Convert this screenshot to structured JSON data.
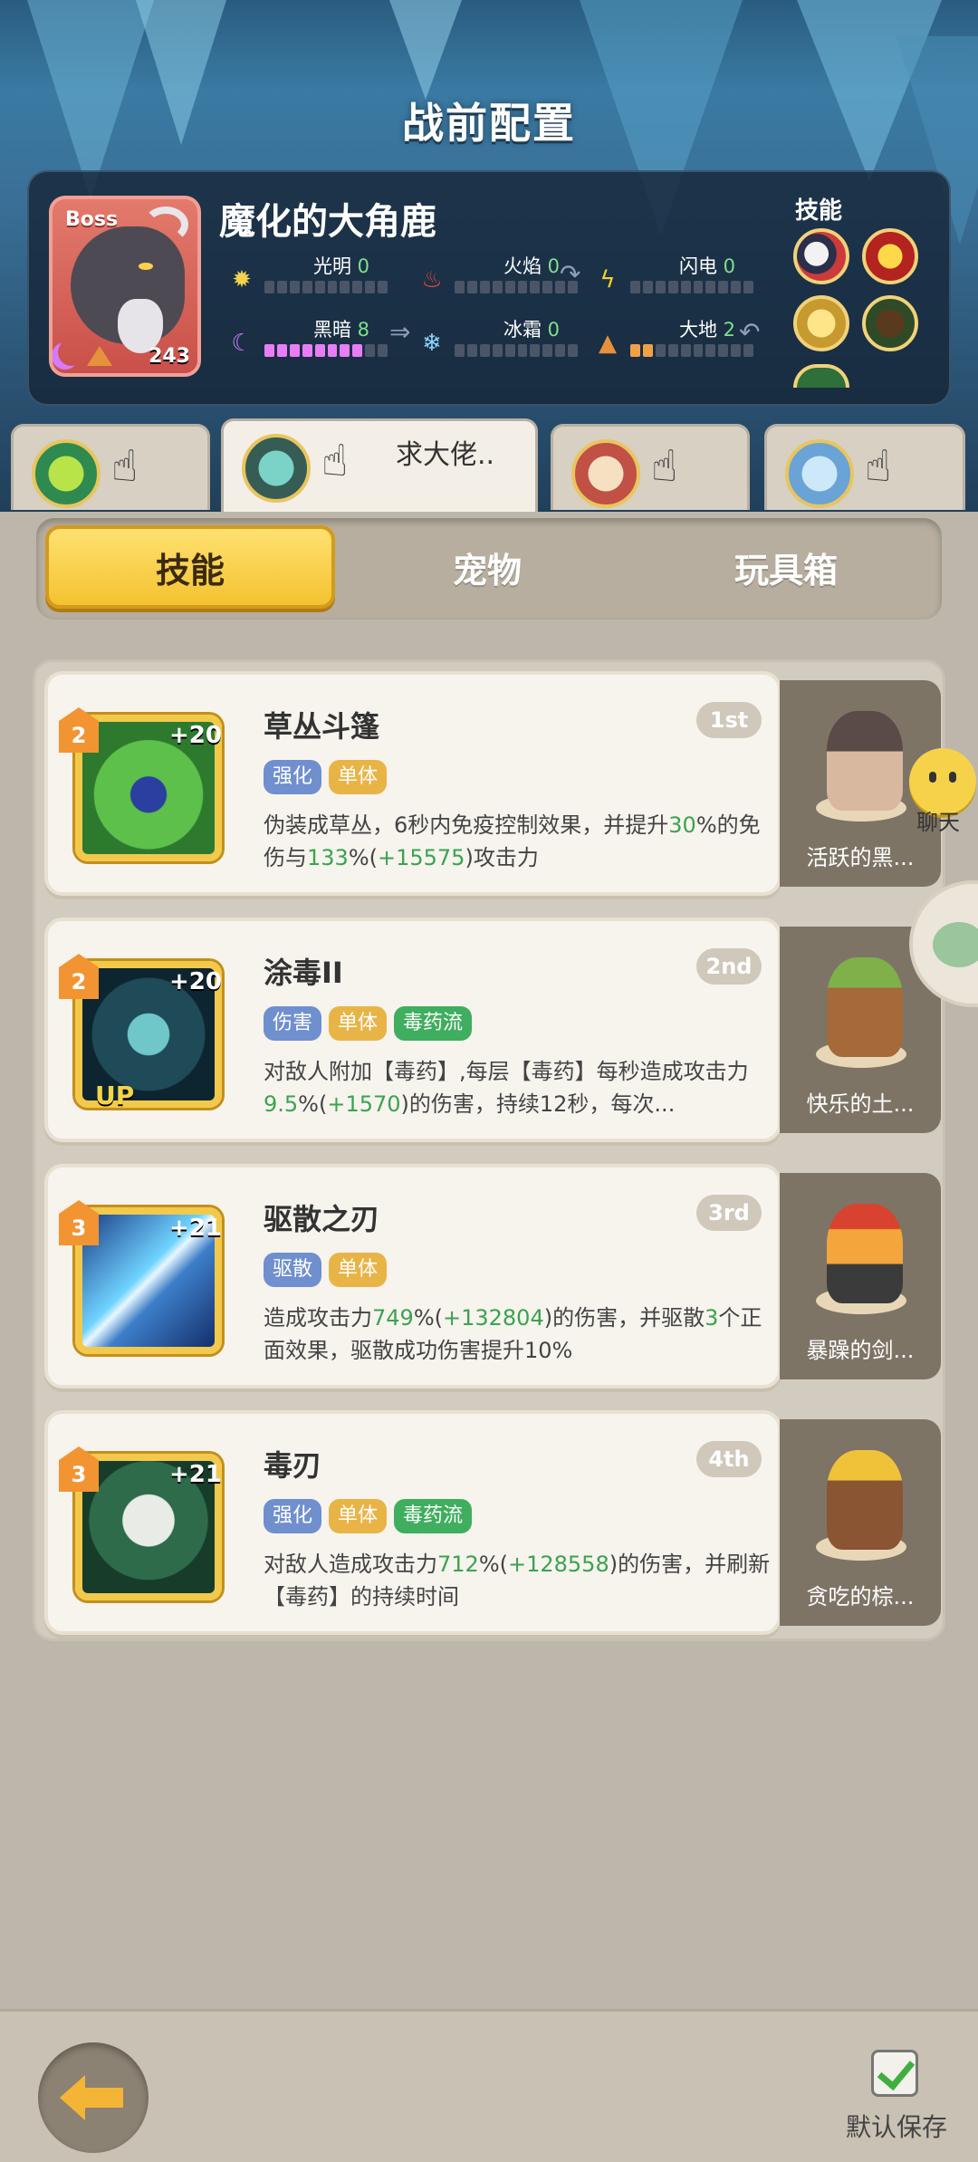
{
  "header": {
    "title": "战前配置"
  },
  "boss": {
    "tag": "Boss",
    "name": "魔化的大角鹿",
    "level": "243",
    "elements": [
      {
        "name": "光明",
        "value": "0"
      },
      {
        "name": "火焰",
        "value": "0"
      },
      {
        "name": "闪电",
        "value": "0"
      },
      {
        "name": "黑暗",
        "value": "8"
      },
      {
        "name": "冰霜",
        "value": "0"
      },
      {
        "name": "大地",
        "value": "2"
      }
    ],
    "skills_label": "技能"
  },
  "teams": [
    {
      "name": ""
    },
    {
      "name": "求大佬.."
    },
    {
      "name": ""
    },
    {
      "name": ""
    }
  ],
  "tabs": {
    "skills": "技能",
    "pets": "宠物",
    "toybox": "玩具箱"
  },
  "skills": [
    {
      "level": "2",
      "bonus": "+20",
      "name": "草丛斗篷",
      "rank": "1st",
      "tags": [
        "强化",
        "单体"
      ],
      "desc_a": "伪装成草丛，6秒内免疫控制效果，并提升",
      "g1": "30",
      "desc_b": "%的免伤与",
      "g2": "133",
      "desc_c": "%(",
      "g3": "+15575",
      "desc_d": ")攻击力",
      "pet": "活跃的黑..."
    },
    {
      "level": "2",
      "bonus": "+20",
      "up": "UP",
      "name": "涂毒II",
      "rank": "2nd",
      "tags": [
        "伤害",
        "单体",
        "毒药流"
      ],
      "desc_a": "对敌人附加【毒药】,每层【毒药】每秒造成攻击力",
      "g1": "9.5",
      "desc_b": "%(",
      "g2": "+1570",
      "desc_c": ")的伤害，持续12秒，每次...",
      "pet": "快乐的土..."
    },
    {
      "level": "3",
      "bonus": "+21",
      "name": "驱散之刃",
      "rank": "3rd",
      "tags": [
        "驱散",
        "单体"
      ],
      "desc_a": "造成攻击力",
      "g1": "749",
      "desc_b": "%(",
      "g2": "+132804",
      "desc_c": ")的伤害，并驱散",
      "g3": "3",
      "desc_d": "个正面效果，驱散成功伤害提升10%",
      "pet": "暴躁的剑..."
    },
    {
      "level": "3",
      "bonus": "+21",
      "name": "毒刃",
      "rank": "4th",
      "tags": [
        "强化",
        "单体",
        "毒药流"
      ],
      "desc_a": "对敌人造成攻击力",
      "g1": "712",
      "desc_b": "%(",
      "g2": "+128558",
      "desc_c": ")的伤害，并刷新【毒药】的持续时间",
      "pet": "贪吃的棕..."
    }
  ],
  "float": {
    "chat": "聊天"
  },
  "bottom": {
    "save": "默认保存"
  }
}
